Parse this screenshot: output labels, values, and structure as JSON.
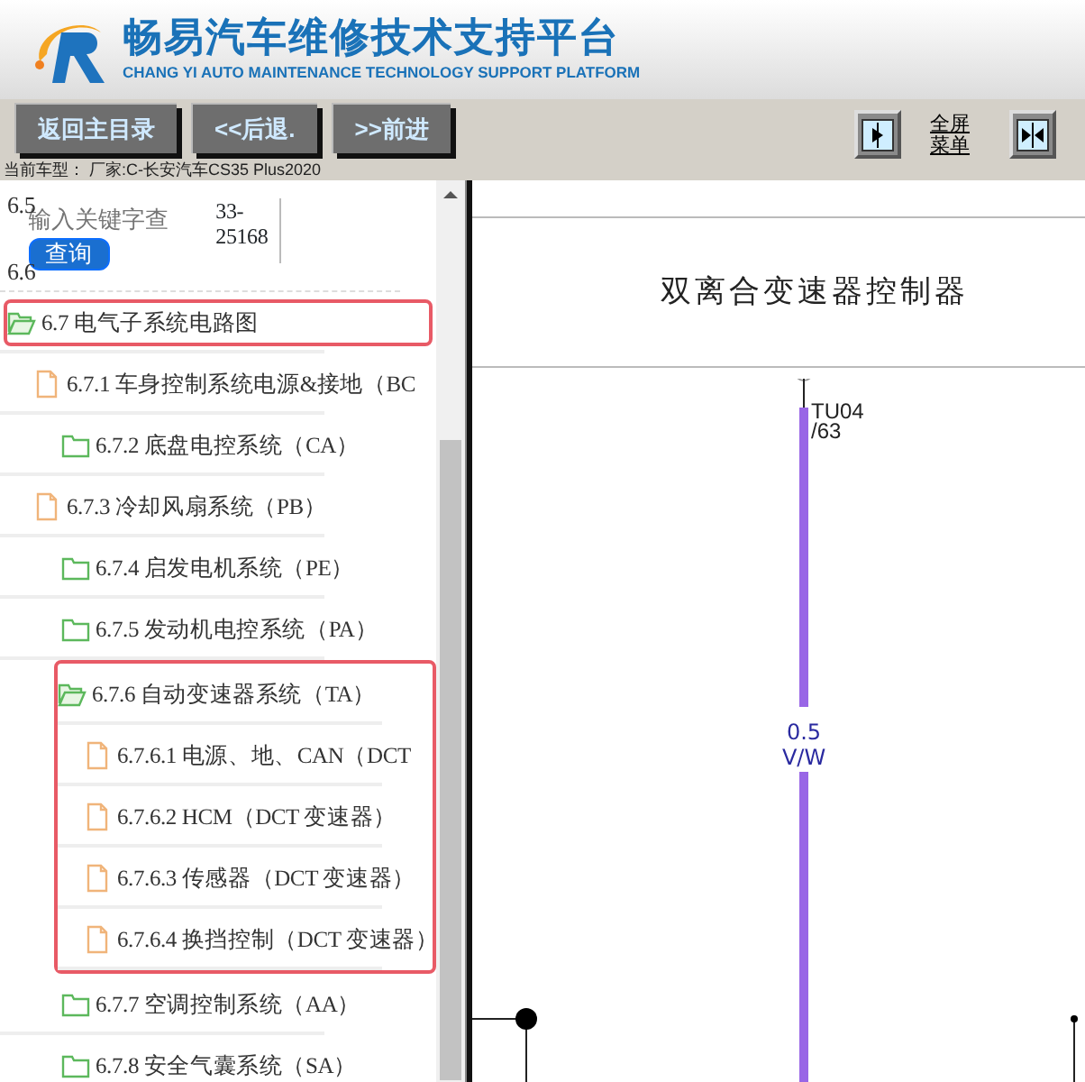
{
  "header": {
    "title": "畅易汽车维修技术支持平台",
    "subtitle": "CHANG YI AUTO MAINTENANCE TECHNOLOGY SUPPORT PLATFORM"
  },
  "toolbar": {
    "buttons": [
      "返回主目录",
      "<<后退.",
      ">>前进"
    ],
    "fullscreen_menu": "全屏菜单"
  },
  "model_line": "当前车型： 厂家:C-长安汽车CS35 Plus2020",
  "search": {
    "labels": [
      "6.5",
      "6.6"
    ],
    "placeholder": "输入关键字查",
    "button": "查询",
    "code": "33-25168"
  },
  "tree": [
    {
      "kind": "folder",
      "label": "6.7 电气子系统电路图",
      "expanded": true,
      "highlighted": true,
      "children": [
        {
          "kind": "file",
          "label": "6.7.1 车身控制系统电源&接地（BC"
        },
        {
          "kind": "folder",
          "label": "6.7.2 底盘电控系统（CA）",
          "expanded": false
        },
        {
          "kind": "file",
          "label": "6.7.3 冷却风扇系统（PB）"
        },
        {
          "kind": "folder",
          "label": "6.7.4 启发电机系统（PE）",
          "expanded": false
        },
        {
          "kind": "folder",
          "label": "6.7.5 发动机电控系统（PA）",
          "expanded": false
        },
        {
          "kind": "folder",
          "label": "6.7.6 自动变速器系统（TA）",
          "expanded": true,
          "group_highlighted": true,
          "children": [
            {
              "kind": "file",
              "label": "6.7.6.1 电源、地、CAN（DCT"
            },
            {
              "kind": "file",
              "label": "6.7.6.2 HCM（DCT 变速器）"
            },
            {
              "kind": "file",
              "label": "6.7.6.3 传感器（DCT 变速器）"
            },
            {
              "kind": "file",
              "label": "6.7.6.4 换挡控制（DCT 变速器）"
            }
          ]
        },
        {
          "kind": "folder",
          "label": "6.7.7 空调控制系统（AA）",
          "expanded": false
        },
        {
          "kind": "folder",
          "label": "6.7.8 安全气囊系统（SA）",
          "expanded": false
        }
      ]
    }
  ],
  "diagram": {
    "title": "双离合变速器控制器",
    "pin": "TU04",
    "pin_number": "/63",
    "wire_size": "0.5",
    "wire_color_code": "V/W"
  }
}
